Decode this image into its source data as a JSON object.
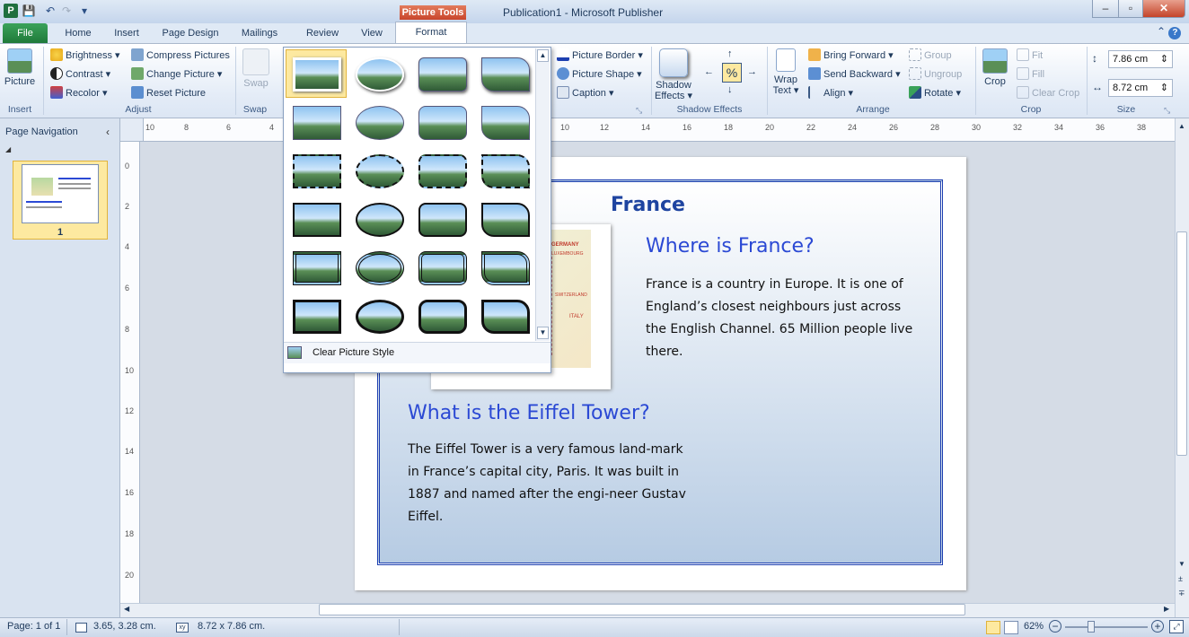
{
  "app": {
    "title": "Publication1 - Microsoft Publisher",
    "context_tab": "Picture Tools",
    "logo_letter": "P"
  },
  "tabs": {
    "file": "File",
    "items": [
      "Home",
      "Insert",
      "Page Design",
      "Mailings",
      "Review",
      "View"
    ],
    "active": "Format"
  },
  "ribbon": {
    "insert": {
      "picture_label": "Picture",
      "group_label": "Insert"
    },
    "adjust": {
      "brightness": "Brightness",
      "contrast": "Contrast",
      "recolor": "Recolor",
      "compress": "Compress Pictures",
      "change_picture": "Change Picture",
      "reset_picture": "Reset Picture",
      "group_label": "Adjust"
    },
    "swap": {
      "label": "Swap",
      "group_label": "Swap"
    },
    "picture_styles": {
      "border": "Picture Border",
      "shape": "Picture Shape",
      "caption": "Caption"
    },
    "shadow": {
      "label": "Shadow Effects",
      "label_line1": "Shadow",
      "label_line2": "Effects",
      "group_label": "Shadow Effects"
    },
    "arrange": {
      "wrap_text_1": "Wrap",
      "wrap_text_2": "Text",
      "bring_forward": "Bring Forward",
      "send_backward": "Send Backward",
      "align": "Align",
      "group": "Group",
      "ungroup": "Ungroup",
      "rotate": "Rotate",
      "group_label": "Arrange"
    },
    "crop": {
      "crop": "Crop",
      "fit": "Fit",
      "fill": "Fill",
      "clear_crop": "Clear Crop",
      "group_label": "Crop"
    },
    "size": {
      "height": "7.86 cm",
      "width": "8.72 cm",
      "group_label": "Size"
    }
  },
  "nav_pane": {
    "title": "Page Navigation",
    "page_number": "1"
  },
  "ruler": {
    "top_ticks": [
      "10",
      "8",
      "6",
      "4",
      "10",
      "12",
      "14",
      "16",
      "18",
      "20",
      "22",
      "24",
      "26",
      "28",
      "30",
      "32",
      "34",
      "36",
      "38"
    ],
    "left_ticks": [
      "0",
      "2",
      "4",
      "6",
      "8",
      "10",
      "12",
      "14",
      "16",
      "18",
      "20"
    ]
  },
  "document": {
    "title": "France",
    "heading_where": "Where is France?",
    "para_where": "France is a country in Europe. It is  one of England’s closest neighbours just across the English Channel. 65 Million people live there.",
    "heading_eiffel": "What is the Eiffel Tower?",
    "para_eiffel": "The Eiffel Tower is a very famous land-mark in France’s capital city, Paris. It was built in 1887 and named after the engi-neer Gustav Eiffel.",
    "map_labels": [
      "GERMANY",
      "LUXEMBOURG",
      "SWITZERLAND",
      "ITALY"
    ]
  },
  "gallery": {
    "clear_label": "Clear Picture Style"
  },
  "status": {
    "page": "Page: 1 of 1",
    "position": "3.65, 3.28 cm.",
    "size": "8.72 x  7.86 cm.",
    "zoom": "62%"
  }
}
